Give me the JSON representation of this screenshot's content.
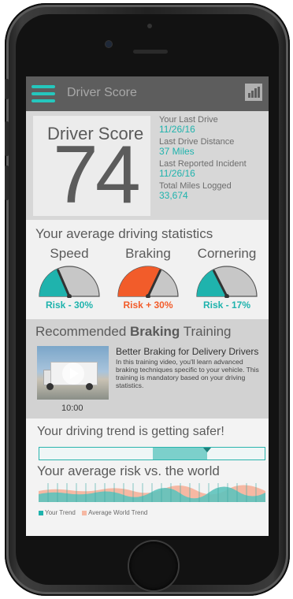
{
  "header": {
    "title": "Driver Score",
    "menu_icon": "hamburger-icon",
    "chart_icon": "bar-chart-icon"
  },
  "score": {
    "label": "Driver Score",
    "value": "74",
    "stats": [
      {
        "label": "Your Last Drive",
        "value": "11/26/16"
      },
      {
        "label": "Last Drive Distance",
        "value": "37 Miles"
      },
      {
        "label": "Last Reported Incident",
        "value": "11/26/16"
      },
      {
        "label": "Total Miles Logged",
        "value": "33,674"
      }
    ]
  },
  "driving_stats": {
    "title": "Your average driving statistics",
    "gauges": [
      {
        "name": "Speed",
        "risk": "Risk - 30%",
        "color": "#1fb3ad",
        "level": 0.37
      },
      {
        "name": "Braking",
        "risk": "Risk + 30%",
        "color": "#f25c2a",
        "level": 0.64
      },
      {
        "name": "Cornering",
        "risk": "Risk - 17%",
        "color": "#1fb3ad",
        "level": 0.35
      }
    ]
  },
  "training": {
    "title_prefix": "Recommended ",
    "title_bold": "Braking",
    "title_suffix": " Training",
    "video_duration": "10:00",
    "video_title": "Better Braking for Delivery Drivers",
    "video_description": "In this training video, you'll learn advanced braking techniques specific to your vehicle. This training is mandatory based on your driving statistics."
  },
  "trend": {
    "title": "Your driving trend is getting safer!",
    "fill_start": 0.505,
    "fill_end": 0.745,
    "marker_position": 0.745,
    "world_title": "Your average risk vs. the world",
    "legend": [
      {
        "label": "Your Trend",
        "color": "#1fb3ad"
      },
      {
        "label": "Average World Trend",
        "color": "#f6b8a3"
      }
    ]
  },
  "colors": {
    "accent": "#1fb3ad",
    "alert": "#f25c2a",
    "header": "#5d5d5d"
  }
}
